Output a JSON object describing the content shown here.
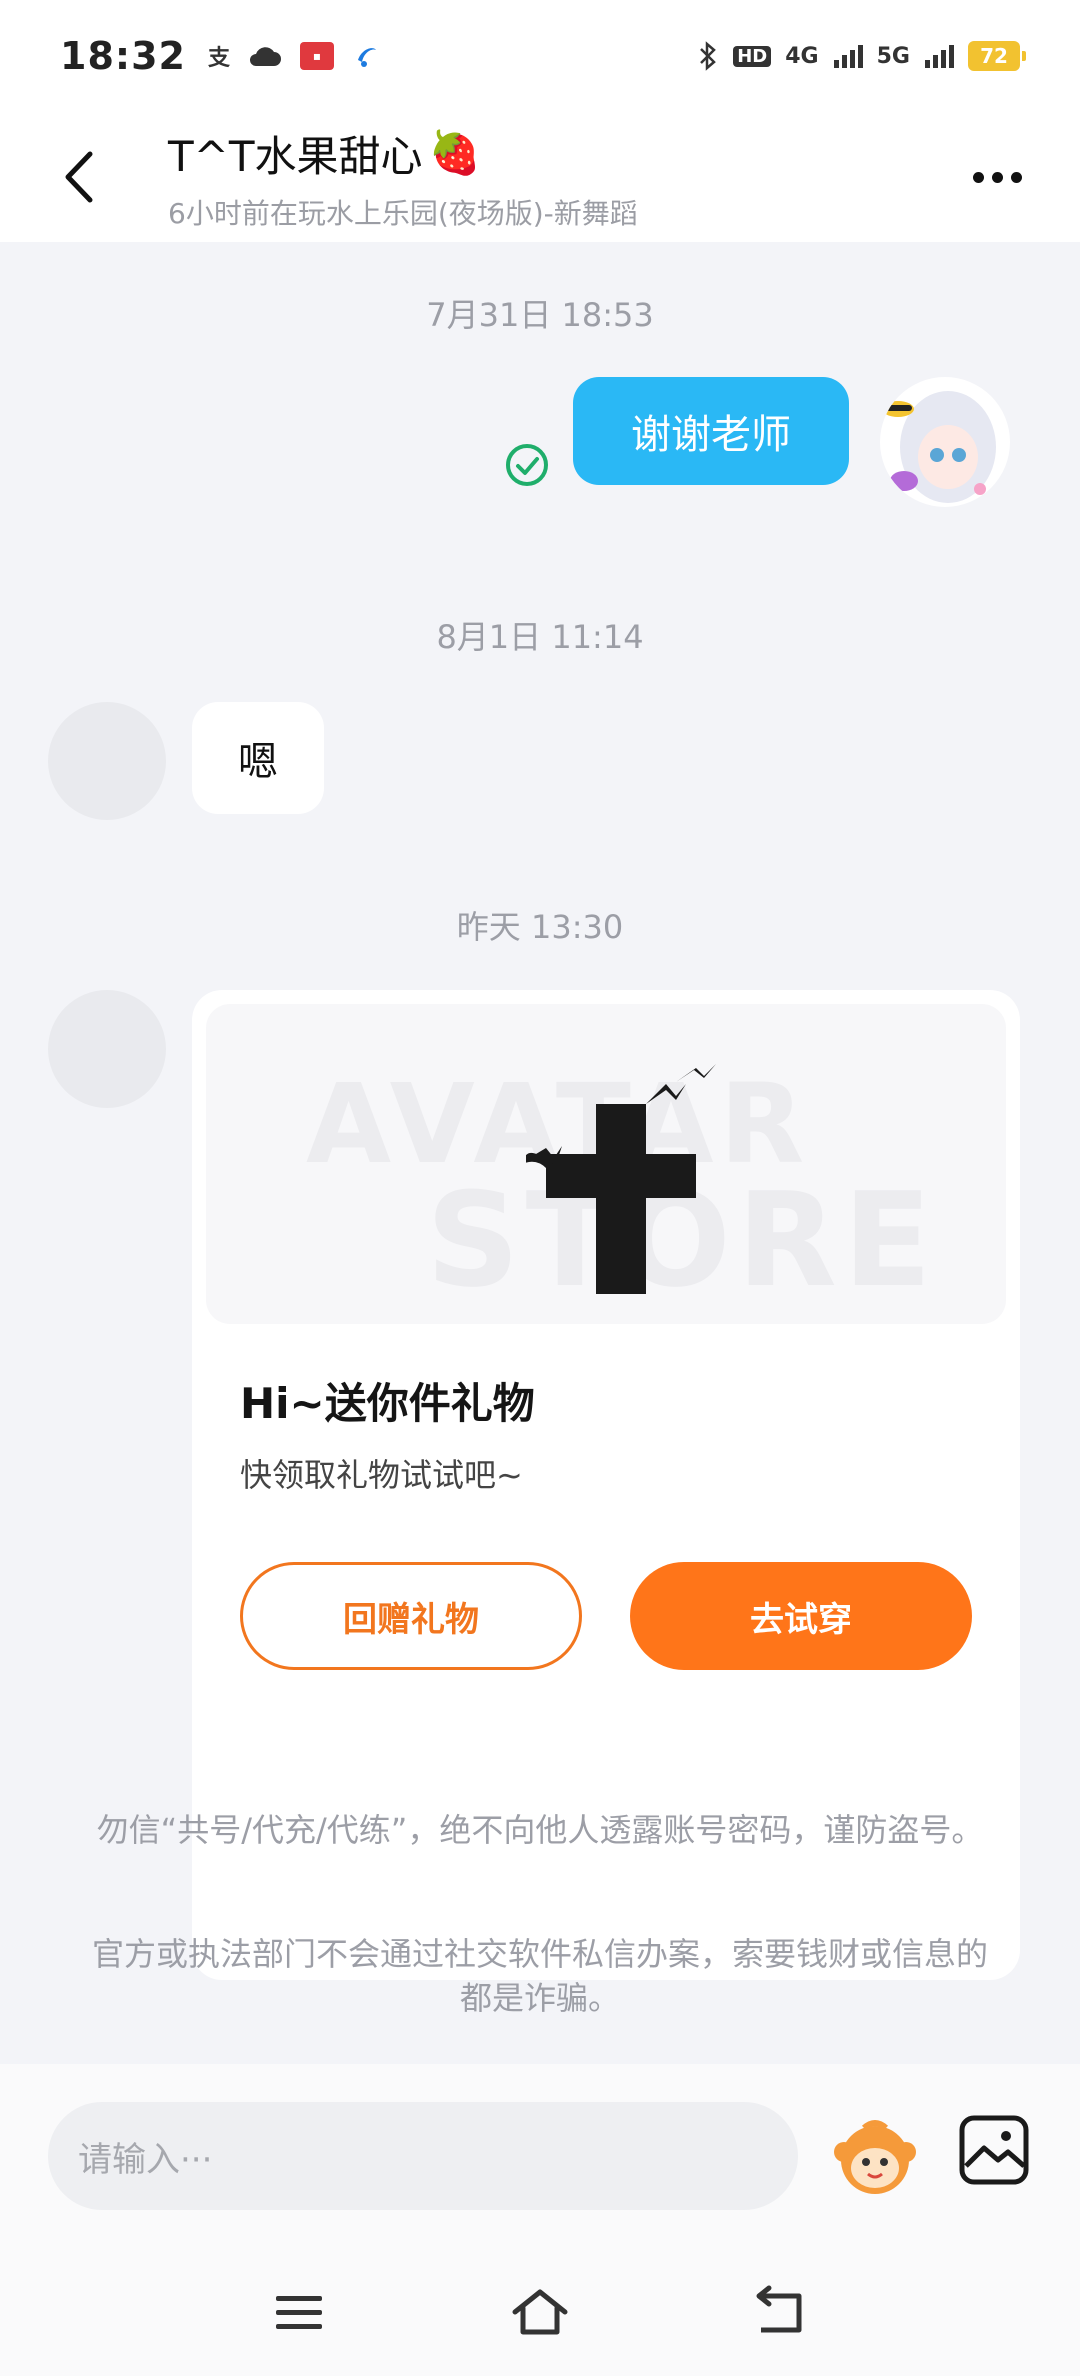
{
  "status_bar": {
    "time": "18:32",
    "network_left": "支",
    "hd": "HD",
    "net_4g": "4G",
    "net_5g": "5G",
    "battery": "72",
    "icons": [
      "alipay-icon",
      "cloud-icon",
      "news-app-icon",
      "telecom-icon",
      "bluetooth-icon",
      "signal-icon",
      "battery-icon"
    ]
  },
  "header": {
    "title": "T^T水果甜心",
    "title_emoji": "🍓",
    "subtitle": "6小时前在玩水上乐园(夜场版)-新舞蹈"
  },
  "messages": {
    "ts1": "7月31日 18:53",
    "out_text": "谢谢老师",
    "ts2": "8月1日 11:14",
    "in_text": "嗯",
    "ts3": "昨天 13:30"
  },
  "gift_card": {
    "watermark_1": "AVATAR",
    "watermark_2": "STORE",
    "title": "Hi~送你件礼物",
    "desc": "快领取礼物试试吧~",
    "return_label": "回赠礼物",
    "try_label": "去试穿"
  },
  "notices": {
    "n1": "勿信“共号/代充/代练”，绝不向他人透露账号密码，谨防盗号。",
    "n2": "官方或执法部门不会通过社交软件私信办案，索要钱财或信息的都是诈骗。"
  },
  "input": {
    "placeholder": "请输入···"
  },
  "colors": {
    "accent_blue": "#2ab8f5",
    "accent_orange": "#ff7519",
    "background": "#f3f4f8"
  }
}
